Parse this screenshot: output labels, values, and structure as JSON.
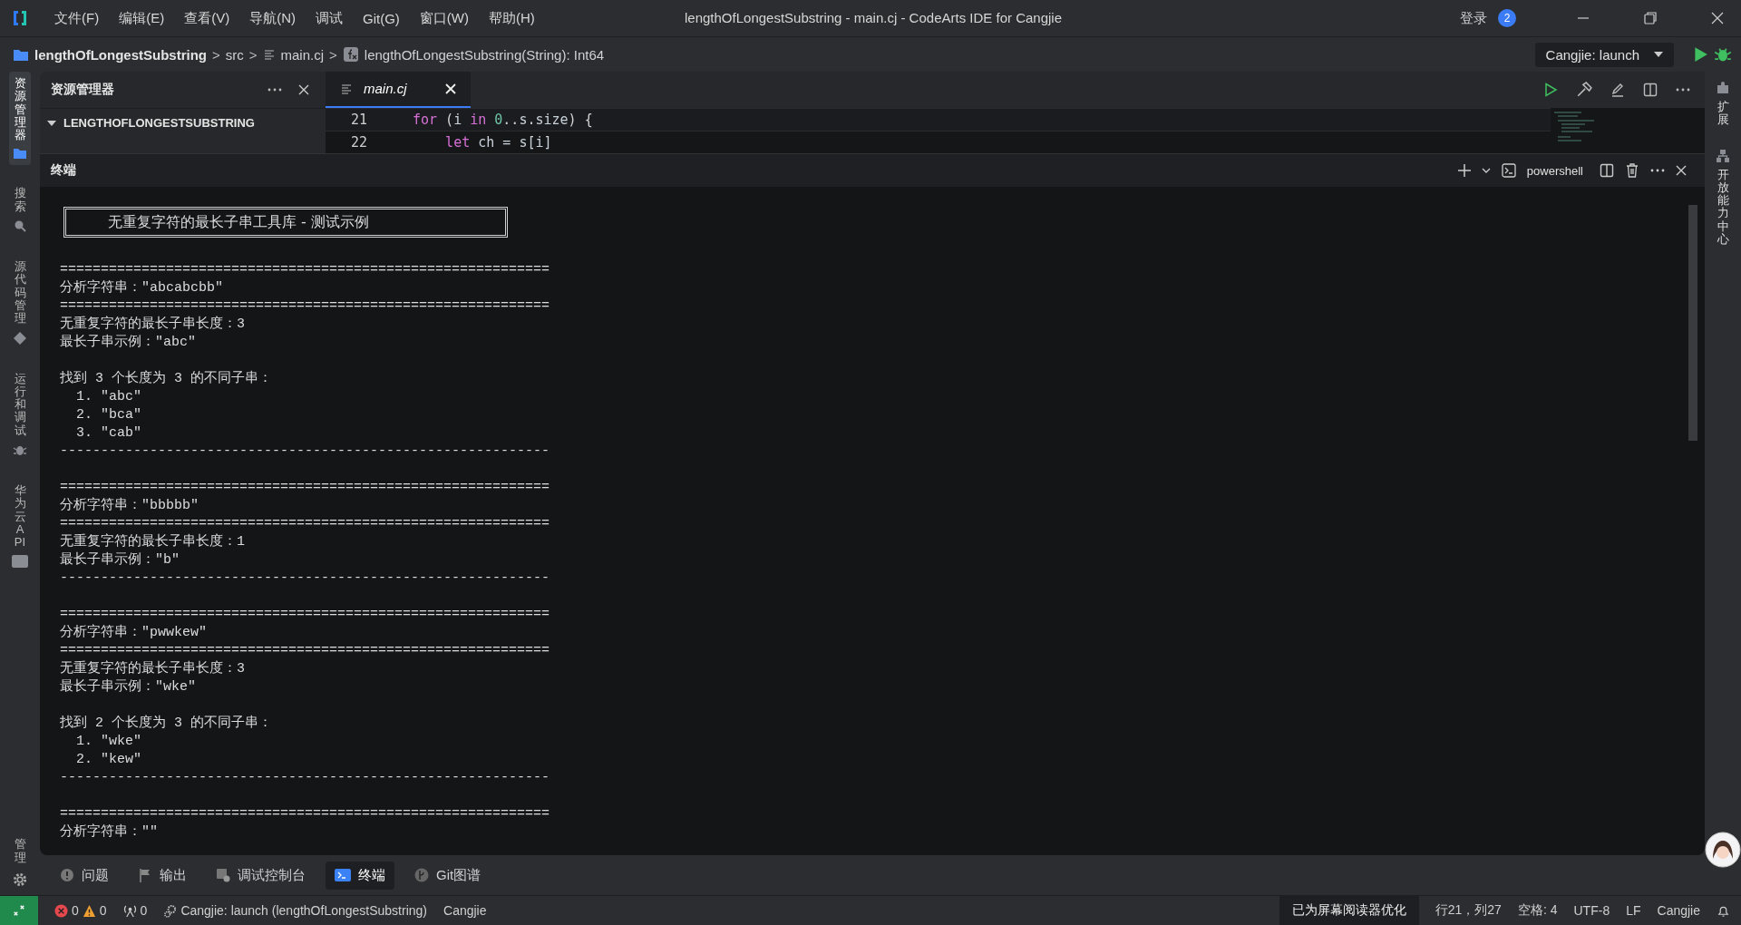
{
  "window": {
    "title": "lengthOfLongestSubstring - main.cj - CodeArts IDE for Cangjie",
    "menu": [
      "文件(F)",
      "编辑(E)",
      "查看(V)",
      "导航(N)",
      "调试",
      "Git(G)",
      "窗口(W)",
      "帮助(H)"
    ],
    "login": "登录",
    "notification_count": "2"
  },
  "breadcrumb": [
    {
      "kind": "folder",
      "label": "lengthOfLongestSubstring"
    },
    {
      "kind": "separator",
      "label": ">"
    },
    {
      "kind": "plain",
      "label": "src"
    },
    {
      "kind": "separator",
      "label": ">"
    },
    {
      "kind": "file",
      "label": "main.cj"
    },
    {
      "kind": "separator",
      "label": ">"
    },
    {
      "kind": "function",
      "label": "lengthOfLongestSubstring(String): Int64"
    }
  ],
  "run_config": "Cangjie: launch",
  "activity_bar": [
    {
      "label": "资源管理器",
      "selected": true
    },
    {
      "label": "搜索",
      "selected": false
    },
    {
      "label": "源代码管理",
      "selected": false
    },
    {
      "label": "运行和调试",
      "selected": false
    },
    {
      "label": "华为云 API",
      "selected": false
    }
  ],
  "manage": "管理",
  "right_bar": [
    {
      "label": "扩展"
    },
    {
      "label": "开放能力中心"
    }
  ],
  "explorer": {
    "title": "资源管理器",
    "root": {
      "label": "LENGTHOFLONGESTSUBSTRING",
      "expanded": true
    }
  },
  "editor": {
    "tabs": [
      {
        "label": "main.cj",
        "selected": true
      }
    ],
    "lines": [
      {
        "number": "21",
        "code": [
          {
            "t": "for",
            "kind": "keyword"
          },
          {
            "t": " (",
            "kind": "punct"
          },
          {
            "t": "i",
            "kind": "ident"
          },
          {
            "t": " in ",
            "kind": "keyword"
          },
          {
            "t": "0",
            "kind": "number"
          },
          {
            "t": "..s.size",
            "kind": "ident"
          },
          {
            "t": ") {",
            "kind": "punct"
          }
        ]
      },
      {
        "number": "22",
        "code": [
          {
            "t": "    let",
            "kind": "keyword"
          },
          {
            "t": " ch = s[i]",
            "kind": "ident"
          }
        ]
      }
    ]
  },
  "terminal": {
    "title": "终端",
    "shell": "powershell",
    "lines": [
      {
        "kind": "box",
        "text": "无重复字符的最长子串工具库 - 测试示例"
      },
      {
        "kind": "blank"
      },
      {
        "kind": "text",
        "text": "============================================================"
      },
      {
        "kind": "text",
        "text": "分析字符串：\"abcabcbb\""
      },
      {
        "kind": "text",
        "text": "============================================================"
      },
      {
        "kind": "text",
        "text": "无重复字符的最长子串长度：3"
      },
      {
        "kind": "text",
        "text": "最长子串示例：\"abc\""
      },
      {
        "kind": "blank"
      },
      {
        "kind": "text",
        "text": "找到 3 个长度为 3 的不同子串："
      },
      {
        "kind": "text",
        "text": "  1. \"abc\""
      },
      {
        "kind": "text",
        "text": "  2. \"bca\""
      },
      {
        "kind": "text",
        "text": "  3. \"cab\""
      },
      {
        "kind": "text",
        "text": "------------------------------------------------------------"
      },
      {
        "kind": "blank"
      },
      {
        "kind": "text",
        "text": "============================================================"
      },
      {
        "kind": "text",
        "text": "分析字符串：\"bbbbb\""
      },
      {
        "kind": "text",
        "text": "============================================================"
      },
      {
        "kind": "text",
        "text": "无重复字符的最长子串长度：1"
      },
      {
        "kind": "text",
        "text": "最长子串示例：\"b\""
      },
      {
        "kind": "text",
        "text": "------------------------------------------------------------"
      },
      {
        "kind": "blank"
      },
      {
        "kind": "text",
        "text": "============================================================"
      },
      {
        "kind": "text",
        "text": "分析字符串：\"pwwkew\""
      },
      {
        "kind": "text",
        "text": "============================================================"
      },
      {
        "kind": "text",
        "text": "无重复字符的最长子串长度：3"
      },
      {
        "kind": "text",
        "text": "最长子串示例：\"wke\""
      },
      {
        "kind": "blank"
      },
      {
        "kind": "text",
        "text": "找到 2 个长度为 3 的不同子串："
      },
      {
        "kind": "text",
        "text": "  1. \"wke\""
      },
      {
        "kind": "text",
        "text": "  2. \"kew\""
      },
      {
        "kind": "text",
        "text": "------------------------------------------------------------"
      },
      {
        "kind": "blank"
      },
      {
        "kind": "text",
        "text": "============================================================"
      },
      {
        "kind": "text",
        "text": "分析字符串：\"\""
      }
    ]
  },
  "panel_tabs": [
    {
      "label": "问题",
      "selected": false
    },
    {
      "label": "输出",
      "selected": false
    },
    {
      "label": "调试控制台",
      "selected": false
    },
    {
      "label": "终端",
      "selected": true
    },
    {
      "label": "Git图谱",
      "selected": false
    }
  ],
  "status_bar": {
    "errors": "0",
    "warnings": "0",
    "ports": "0",
    "launch": "Cangjie: launch (lengthOfLongestSubstring)",
    "language_left": "Cangjie",
    "screen_reader": "已为屏幕阅读器优化",
    "position": "行21，列27",
    "indent": "空格: 4",
    "encoding": "UTF-8",
    "eol": "LF",
    "language": "Cangjie"
  }
}
